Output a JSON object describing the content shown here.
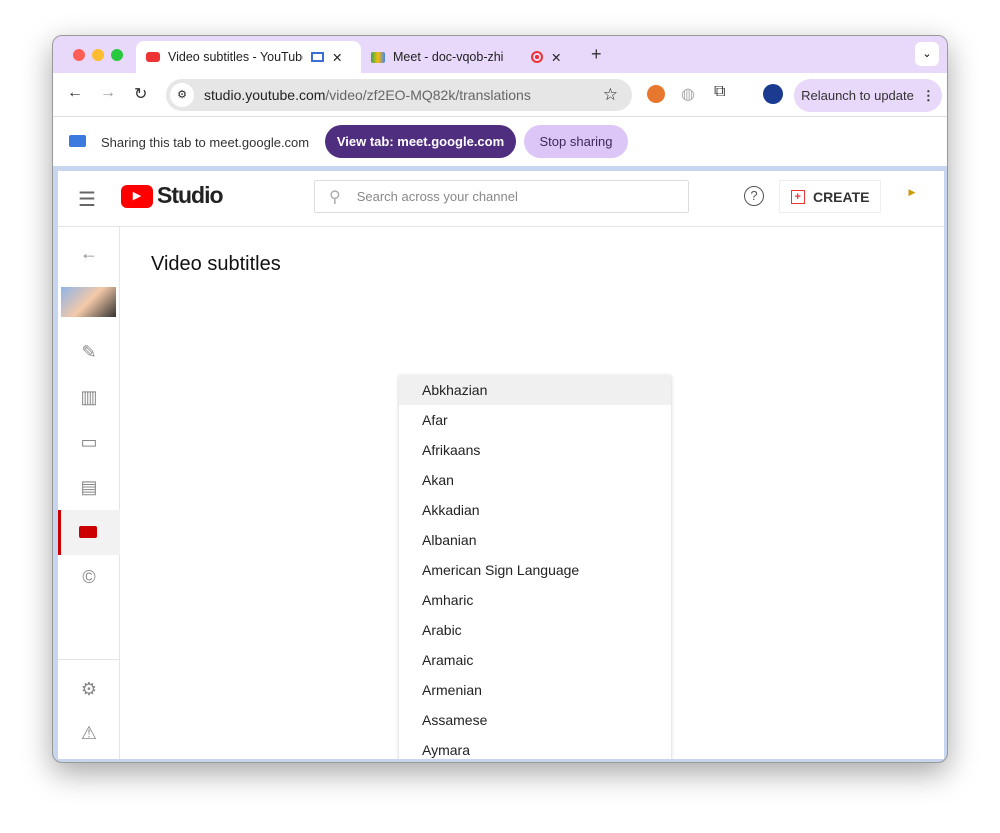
{
  "browser": {
    "tabs": [
      {
        "title": "Video subtitles - YouTube",
        "active": true
      },
      {
        "title": "Meet - doc-vqob-zhi",
        "active": false
      }
    ],
    "url_host": "studio.youtube.com",
    "url_path": "/video/zf2EO-MQ82k/translations",
    "relaunch_label": "Relaunch to update"
  },
  "sharing": {
    "text": "Sharing this tab to meet.google.com",
    "view_tab_label": "View tab: meet.google.com",
    "stop_label": "Stop sharing"
  },
  "studio": {
    "logo_text": "Studio",
    "search_placeholder": "Search across your channel",
    "create_label": "CREATE",
    "page_title": "Video subtitles"
  },
  "languages": [
    "Abkhazian",
    "Afar",
    "Afrikaans",
    "Akan",
    "Akkadian",
    "Albanian",
    "American Sign Language",
    "Amharic",
    "Arabic",
    "Aramaic",
    "Armenian",
    "Assamese",
    "Aymara"
  ],
  "colors": {
    "accent_purple": "#4f2d7f",
    "tab_strip": "#e8d8fa",
    "youtube_red": "#ff0000"
  }
}
